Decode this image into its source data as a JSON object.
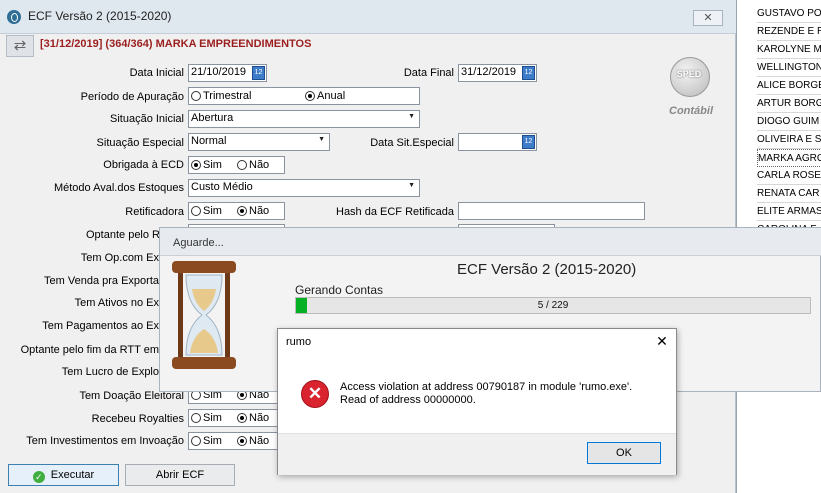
{
  "window": {
    "title": "ECF Versão 2 (2015-2020)",
    "close_glyph": "✕"
  },
  "header": {
    "company": "[31/12/2019] (364/364) MARKA EMPREENDIMENTOS",
    "nav_glyph": "⇄"
  },
  "form": {
    "data_inicial": {
      "label": "Data Inicial",
      "value": "21/10/2019"
    },
    "data_final": {
      "label": "Data Final",
      "value": "31/12/2019"
    },
    "periodo": {
      "label": "Período de Apuração",
      "opt1": "Trimestral",
      "opt2": "Anual",
      "selected": "Anual"
    },
    "situacao_inicial": {
      "label": "Situação Inicial",
      "value": "Abertura"
    },
    "situacao_especial": {
      "label": "Situação Especial",
      "value": "Normal"
    },
    "data_sit_especial": {
      "label": "Data Sit.Especial",
      "value": ""
    },
    "obrigada_ecd": {
      "label": "Obrigada à ECD",
      "opt1": "Sim",
      "opt2": "Não",
      "selected": "Sim"
    },
    "metodo_aval": {
      "label": "Método Aval.dos Estoques",
      "value": "Custo Médio"
    },
    "retificadora": {
      "label": "Retificadora",
      "opt1": "Sim",
      "opt2": "Não",
      "selected": "Não"
    },
    "hash_ecf": {
      "label": "Hash da ECF Retificada",
      "value": ""
    },
    "optante_pelo": {
      "label": "Optante pelo R"
    },
    "tem_op_com": {
      "label": "Tem Op.com Ex"
    },
    "tem_venda": {
      "label": "Tem Venda pra Exporta"
    },
    "tem_ativos": {
      "label": "Tem Ativos no Ex"
    },
    "tem_pagamentos": {
      "label": "Tem Pagamentos ao Ex"
    },
    "optante_rtt": {
      "label": "Optante pelo fim da RTT em"
    },
    "tem_lucro": {
      "label": "Tem Lucro de Explo"
    },
    "tem_doacao": {
      "label": "Tem Doação Eleitoral",
      "opt1": "Sim",
      "opt2": "Não",
      "selected": "Não"
    },
    "recebeu_royalties": {
      "label": "Recebeu Royalties",
      "opt1": "Sim",
      "opt2": "Não",
      "selected": "Não"
    },
    "tem_investimentos": {
      "label": "Tem Investimentos em Invoação",
      "opt1": "Sim",
      "opt2": "Não",
      "selected": "Não"
    }
  },
  "logo": {
    "circle_text": "SPED",
    "caption": "Contábil"
  },
  "buttons": {
    "executar": "Executar",
    "abrir_ecf": "Abrir ECF"
  },
  "right_list": [
    "GUSTAVO PO",
    "REZENDE E R",
    "KAROLYNE M",
    "WELLINGTON",
    "ALICE BORGE",
    "ARTUR BORG",
    "DIOGO GUIM",
    "OLIVEIRA E S",
    "MARKA AGRO",
    "CARLA ROSE",
    "RENATA CAR",
    "ELITE ARMAS",
    "CAROLINA F"
  ],
  "wait_dialog": {
    "title": "Aguarde...",
    "heading": "ECF Versão 2 (2015-2020)",
    "status": "Gerando Contas",
    "progress_text": "5 / 229",
    "progress_current": 5,
    "progress_total": 229
  },
  "error_dialog": {
    "title": "rumo",
    "close_glyph": "✕",
    "icon_glyph": "✕",
    "message_line1": "Access violation at address 00790187 in module 'rumo.exe'.",
    "message_line2": "Read of address 00000000.",
    "ok_label": "OK"
  },
  "colors": {
    "accent": "#0078d7",
    "progress": "#06b025",
    "company": "#9b1f1f",
    "error": "#d9232f"
  }
}
